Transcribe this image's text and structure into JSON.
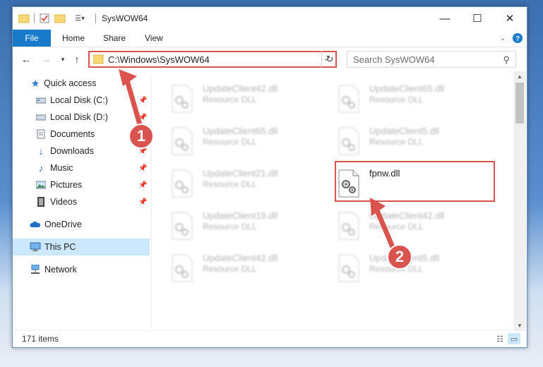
{
  "window": {
    "title": "SysWOW64",
    "controls": {
      "minimize": "—",
      "maximize": "☐",
      "close": "✕"
    }
  },
  "ribbon": {
    "tabs": [
      "File",
      "Home",
      "Share",
      "View"
    ],
    "expand_icon": "chevron-down-icon",
    "help_icon": "help-icon"
  },
  "address": {
    "path": "C:\\Windows\\SysWOW64",
    "search_placeholder": "Search SysWOW64"
  },
  "sidebar": {
    "items": [
      {
        "label": "Quick access",
        "icon": "star-icon",
        "pinned": false
      },
      {
        "label": "Local Disk (C:)",
        "icon": "drive-icon",
        "pinned": true
      },
      {
        "label": "Local Disk (D:)",
        "icon": "drive-icon",
        "pinned": true
      },
      {
        "label": "Documents",
        "icon": "documents-icon",
        "pinned": true
      },
      {
        "label": "Downloads",
        "icon": "download-icon",
        "pinned": true
      },
      {
        "label": "Music",
        "icon": "music-icon",
        "pinned": true
      },
      {
        "label": "Pictures",
        "icon": "pictures-icon",
        "pinned": true
      },
      {
        "label": "Videos",
        "icon": "videos-icon",
        "pinned": true
      },
      {
        "label": "OneDrive",
        "icon": "cloud-icon",
        "pinned": false
      },
      {
        "label": "This PC",
        "icon": "computer-icon",
        "pinned": false,
        "selected": true
      },
      {
        "label": "Network",
        "icon": "network-icon",
        "pinned": false
      }
    ]
  },
  "files": [
    {
      "name": "UpdateClient42.dll",
      "type": "Resource DLL",
      "blurred": true
    },
    {
      "name": "UpdateClient65.dll",
      "type": "Resource DLL",
      "blurred": true
    },
    {
      "name": "UpdateClient65.dll",
      "type": "Resource DLL",
      "blurred": true
    },
    {
      "name": "UpdateClient5.dll",
      "type": "Resource DLL",
      "blurred": true
    },
    {
      "name": "UpdateClient21.dll",
      "type": "Resource DLL",
      "blurred": true
    },
    {
      "name": "fpnw.dll",
      "type": "",
      "blurred": false,
      "highlighted": true
    },
    {
      "name": "UpdateClient19.dll",
      "type": "Resource DLL",
      "blurred": true
    },
    {
      "name": "UpdateClient42.dll",
      "type": "Resource DLL",
      "blurred": true
    },
    {
      "name": "UpdateClient42.dll",
      "type": "Resource DLL",
      "blurred": true
    },
    {
      "name": "UpdateClient5.dll",
      "type": "Resource DLL",
      "blurred": true
    }
  ],
  "status": {
    "item_count": "171 items"
  },
  "annotations": {
    "badge1": "1",
    "badge2": "2",
    "color": "#d9534f"
  },
  "colors": {
    "accent": "#1979ca",
    "selection": "#cce8ff",
    "highlight": "#d9534f"
  }
}
